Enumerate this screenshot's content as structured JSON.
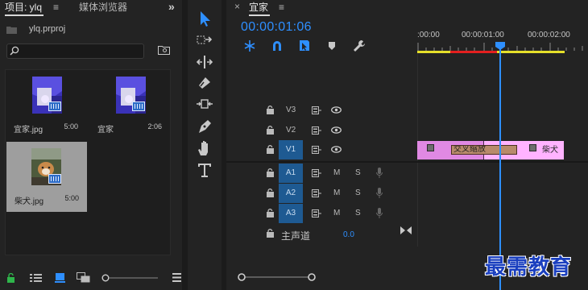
{
  "project_panel": {
    "tab_project": "项目: ylq",
    "tab_media": "媒体浏览器",
    "menu_icon": "menu-lines-icon",
    "overflow_icon": "double-chevron-right-icon",
    "project_file": "ylq.prproj",
    "search": {
      "placeholder": "",
      "value": ""
    },
    "items": [
      {
        "name": "宜家.jpg",
        "duration": "5:00"
      },
      {
        "name": "宜家",
        "duration": "2:06"
      },
      {
        "name": "柴犬.jpg",
        "duration": "5:00"
      }
    ],
    "bottom_icons": [
      "lock-icon",
      "list-view-icon",
      "icon-view-icon",
      "freeform-view-icon",
      "zoom-slider-icon",
      "menu-lines-icon"
    ]
  },
  "tools": [
    "selection-tool-icon",
    "track-select-tool-icon",
    "ripple-edit-tool-icon",
    "razor-tool-icon",
    "slip-tool-icon",
    "pen-tool-icon",
    "hand-tool-icon",
    "type-tool-icon"
  ],
  "timeline": {
    "sequence_name": "宜家",
    "timecode": "00:00:01:06",
    "ruler_labels": [
      ":00:00",
      "00:00:01:00",
      "00:00:02:00"
    ],
    "tracks": [
      {
        "name": "V3",
        "type": "video",
        "selected": false
      },
      {
        "name": "V2",
        "type": "video",
        "selected": false
      },
      {
        "name": "V1",
        "type": "video",
        "selected": true
      },
      {
        "name": "A1",
        "type": "audio",
        "selected": true
      },
      {
        "name": "A2",
        "type": "audio",
        "selected": true
      },
      {
        "name": "A3",
        "type": "audio",
        "selected": true
      }
    ],
    "audio_buttons": {
      "mute": "M",
      "solo": "S"
    },
    "master": {
      "label": "主声道",
      "value": "0.0"
    },
    "clips": {
      "transition": "交叉缩放",
      "clip_b_name": "柴犬"
    }
  },
  "watermark": "最需教育",
  "colors": {
    "accent": "#2e8fff",
    "clip_pink": "#ffb3ff",
    "clip_magenta": "#e089e3",
    "track_selected": "#1e5a92",
    "transition": "#b88a6b",
    "work_area": "#e5df2a"
  }
}
